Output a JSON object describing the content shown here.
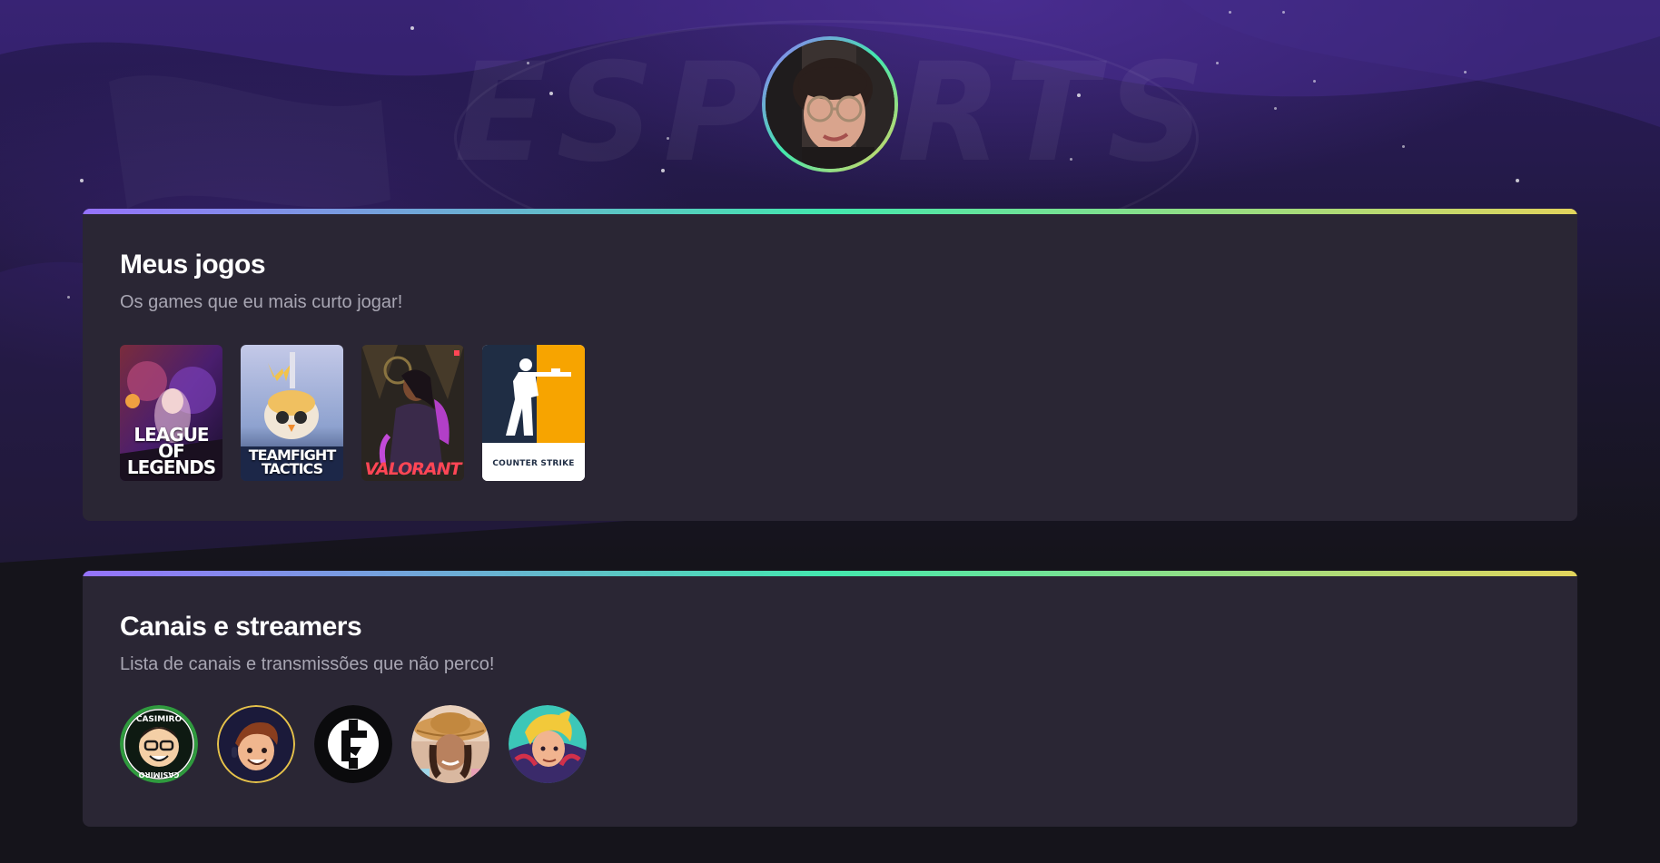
{
  "profile": {
    "avatar_icon": "profile-photo"
  },
  "hero": {
    "background_logo_text": "ESPORTS"
  },
  "games_section": {
    "title": "Meus jogos",
    "subtitle": "Os games que eu mais curto jogar!",
    "games": [
      {
        "name_line1": "LEAGUE OF",
        "name_line2": "LEGENDS",
        "icon": "league-of-legends-cover"
      },
      {
        "name_line1": "TEAMFIGHT",
        "name_line2": "TACTICS",
        "icon": "teamfight-tactics-cover"
      },
      {
        "name_line1": "VALORANT",
        "name_line2": "",
        "icon": "valorant-cover"
      },
      {
        "name_line1": "COUNTER STRIKE",
        "name_line2": "",
        "icon": "counter-strike-cover"
      }
    ]
  },
  "streamers_section": {
    "title": "Canais e streamers",
    "subtitle": "Lista de canais e transmissões que não perco!",
    "streamers": [
      {
        "icon": "casimiro-avatar",
        "badge_text": "CASIMIRO"
      },
      {
        "icon": "streamer-cartoon-avatar"
      },
      {
        "icon": "channel-logo-avatar"
      },
      {
        "icon": "streamer-photo-avatar"
      },
      {
        "icon": "streamer-anime-avatar"
      }
    ]
  },
  "colors": {
    "gradient_start": "#9572fc",
    "gradient_mid": "#43e7ad",
    "gradient_end": "#e2d45c",
    "card_bg": "#2a2634",
    "page_bg": "#15141b",
    "subtitle_text": "#a8a6b3"
  }
}
